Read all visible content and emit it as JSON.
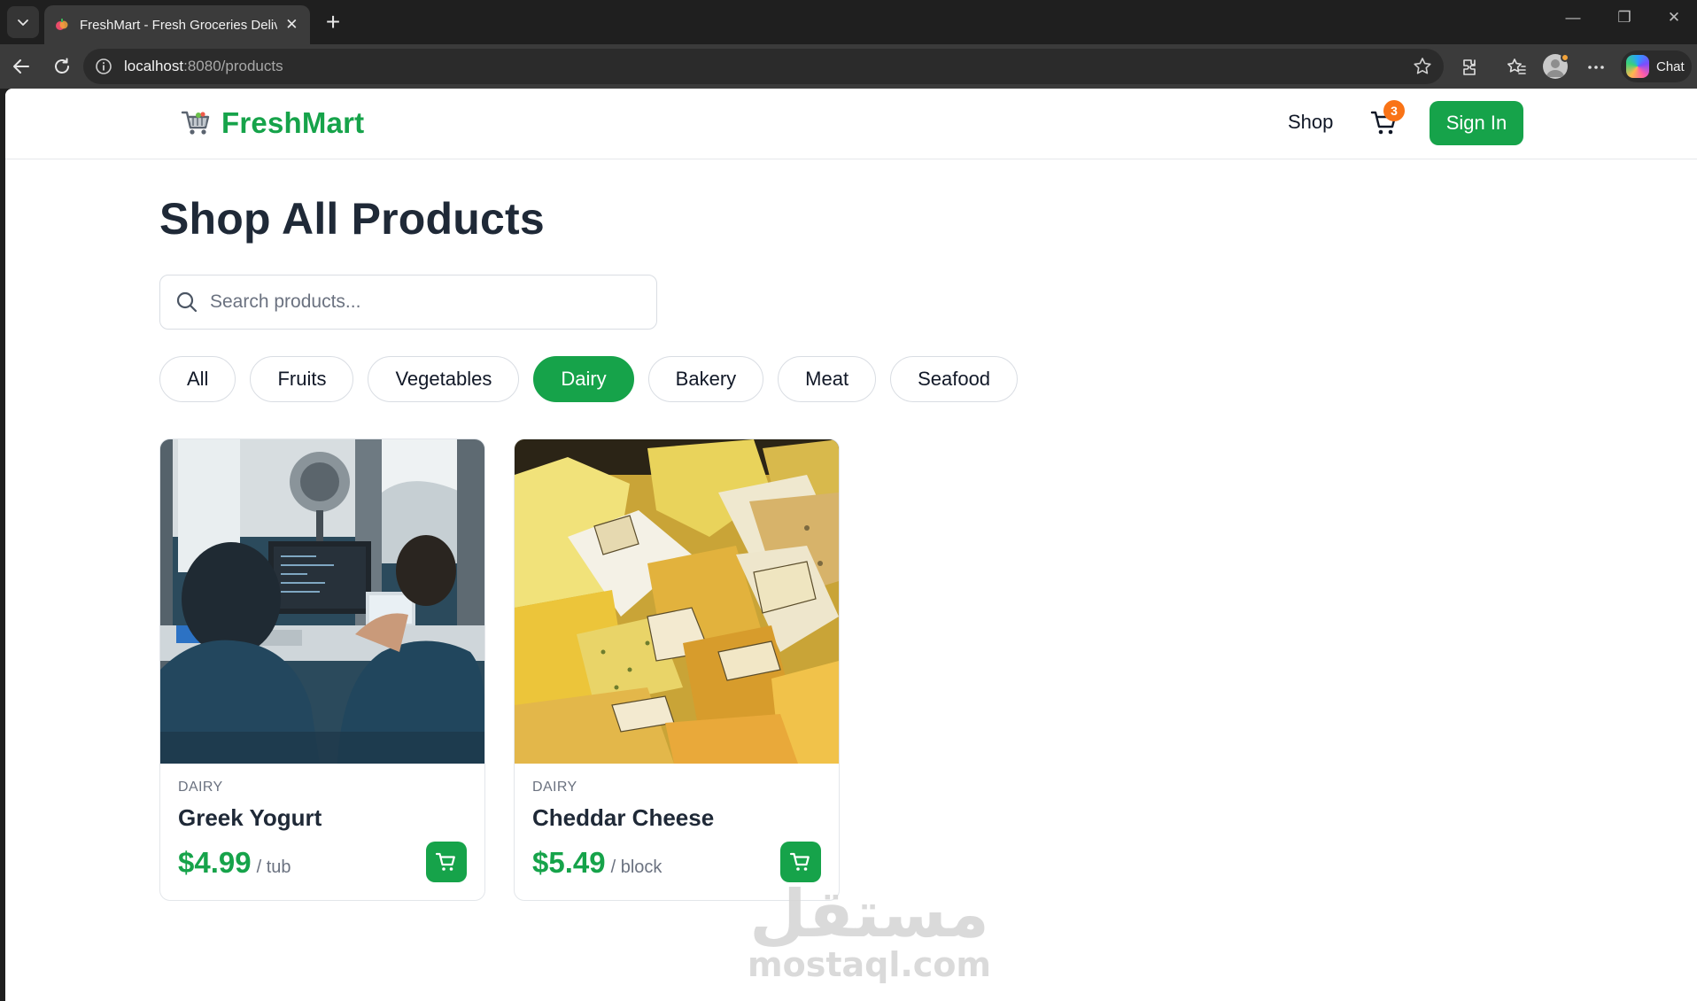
{
  "browser": {
    "tab_title": "FreshMart - Fresh Groceries Delivered",
    "url_host": "localhost",
    "url_rest": ":8080/products",
    "chat_label": "Chat"
  },
  "header": {
    "brand": "FreshMart",
    "nav_shop": "Shop",
    "cart_count": "3",
    "signin_label": "Sign In"
  },
  "page": {
    "title": "Shop All Products",
    "search_placeholder": "Search products...",
    "categories": [
      {
        "label": "All",
        "active": false
      },
      {
        "label": "Fruits",
        "active": false
      },
      {
        "label": "Vegetables",
        "active": false
      },
      {
        "label": "Dairy",
        "active": true
      },
      {
        "label": "Bakery",
        "active": false
      },
      {
        "label": "Meat",
        "active": false
      },
      {
        "label": "Seafood",
        "active": false
      }
    ]
  },
  "products": [
    {
      "category": "DAIRY",
      "name": "Greek Yogurt",
      "price": "$4.99",
      "unit": "/ tub",
      "image": "people-at-computers-photo"
    },
    {
      "category": "DAIRY",
      "name": "Cheddar Cheese",
      "price": "$5.49",
      "unit": "/ block",
      "image": "cheese-blocks-photo"
    }
  ],
  "watermark": {
    "arabic": "مستقل",
    "latin": "mostaql.com"
  },
  "colors": {
    "brand_green": "#16a34a",
    "badge_orange": "#f97316"
  }
}
